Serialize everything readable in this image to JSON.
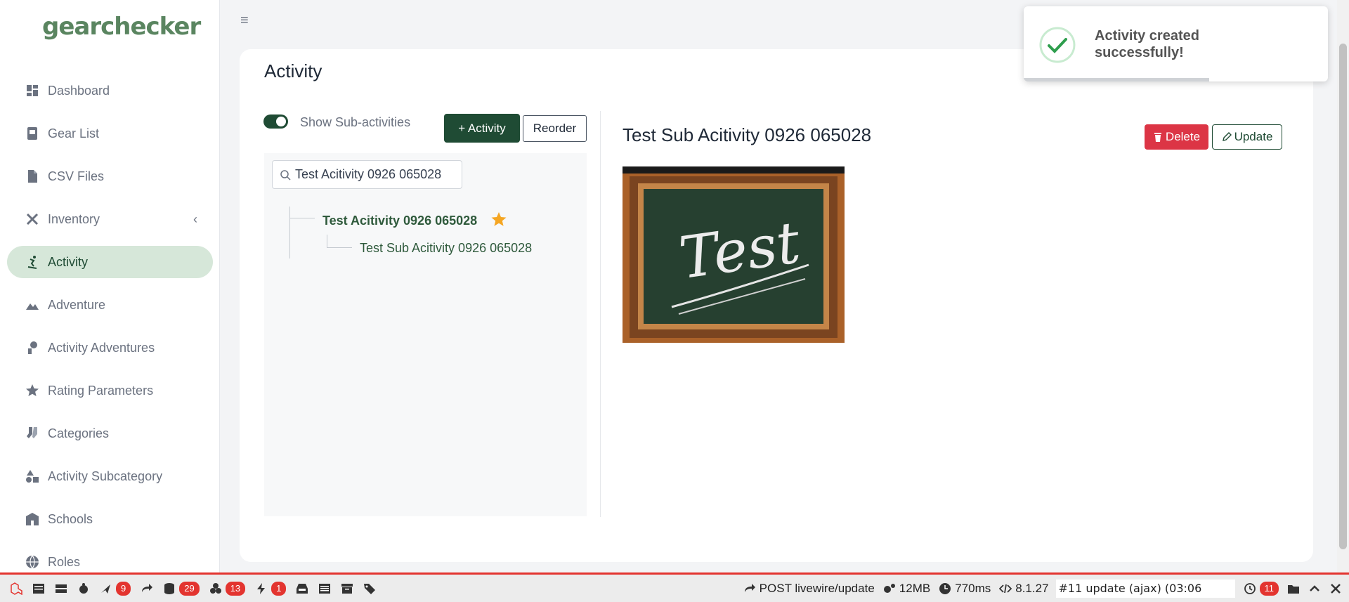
{
  "app": {
    "logo": "gearchecker",
    "menu_icon": "hamburger-icon"
  },
  "sidebar": {
    "items": [
      {
        "label": "Dashboard",
        "icon": "dashboard-icon"
      },
      {
        "label": "Gear List",
        "icon": "gear-list-icon"
      },
      {
        "label": "CSV Files",
        "icon": "file-icon"
      },
      {
        "label": "Inventory",
        "icon": "tools-icon"
      },
      {
        "label": "Activity",
        "icon": "skiing-icon",
        "active": true
      },
      {
        "label": "Adventure",
        "icon": "mountain-icon"
      },
      {
        "label": "Activity Adventures",
        "icon": "person-icon"
      },
      {
        "label": "Rating Parameters",
        "icon": "star-icon"
      },
      {
        "label": "Categories",
        "icon": "socks-icon"
      },
      {
        "label": "Activity Subcategory",
        "icon": "shapes-icon"
      },
      {
        "label": "Schools",
        "icon": "school-icon"
      },
      {
        "label": "Roles",
        "icon": "globe-icon"
      }
    ],
    "expand_glyph": "‹"
  },
  "page": {
    "title": "Activity",
    "toggle_label": "Show Sub-activities",
    "toggle_on": true,
    "add_button": "+ Activity",
    "reorder_button": "Reorder",
    "search_value": "Test Acitivity 0926 065028",
    "tree": {
      "parent": "Test Acitivity 0926 065028",
      "child": "Test Sub Acitivity 0926 065028"
    },
    "detail": {
      "title": "Test Sub Acitivity 0926 065028",
      "delete_button": "Delete",
      "update_button": "Update",
      "image_text": "Test"
    }
  },
  "toast": {
    "message": "Activity created successfully!",
    "progress": 0.61
  },
  "debugbar": {
    "badges": {
      "views": "9",
      "queries": "29",
      "models": "13",
      "events": "1",
      "history": "11"
    },
    "request": "POST livewire/update",
    "memory": "12MB",
    "time": "770ms",
    "php": "8.1.27",
    "selected_request": "#11 update (ajax) (03:06"
  },
  "colors": {
    "brand": "#1f4b34",
    "danger": "#dc3545",
    "active_bg": "#d6e7d9",
    "debug_red": "#e3342f"
  }
}
